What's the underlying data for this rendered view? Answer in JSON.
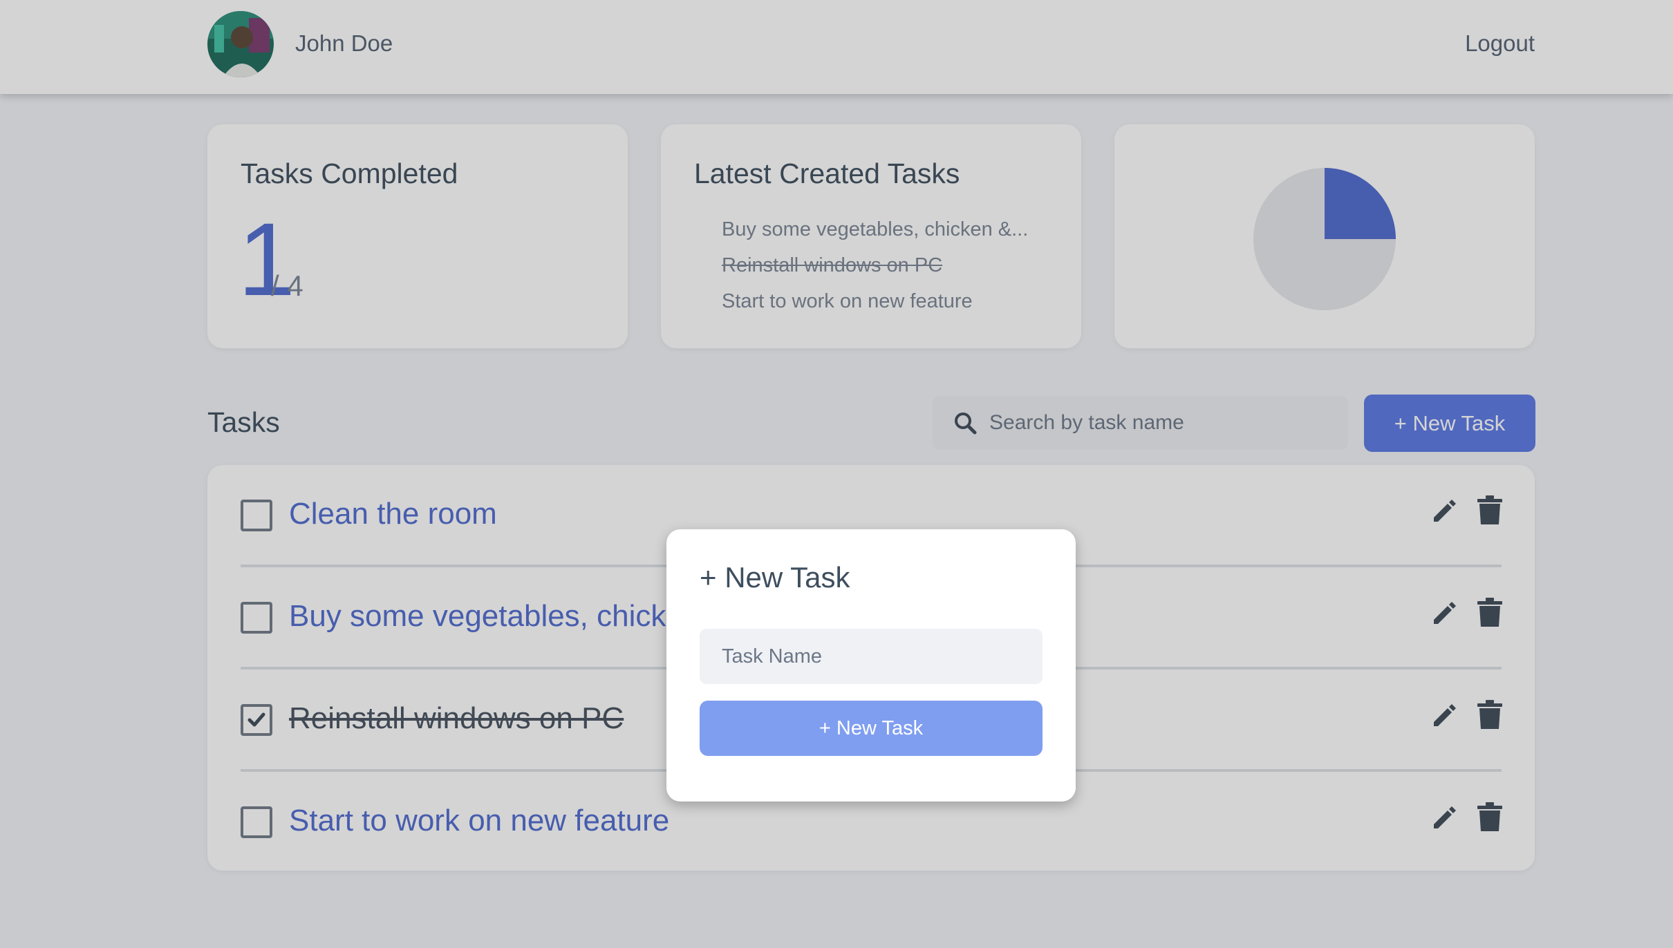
{
  "header": {
    "user_name": "John Doe",
    "logout_label": "Logout"
  },
  "stats": {
    "completed_title": "Tasks Completed",
    "completed_count": "1",
    "total_count": "/ 4",
    "latest_title": "Latest Created Tasks",
    "latest_tasks": [
      {
        "label": "Buy some vegetables, chicken &...",
        "done": false
      },
      {
        "label": "Reinstall windows on PC",
        "done": true
      },
      {
        "label": "Start to work on new feature",
        "done": false
      }
    ],
    "pie": {
      "completed_fraction": 0.25,
      "completed_color": "#4f6bd0",
      "remaining_color": "#e6e8eb"
    }
  },
  "tasks": {
    "heading": "Tasks",
    "search_placeholder": "Search by task name",
    "new_task_label": "+ New Task",
    "items": [
      {
        "label": "Clean the room",
        "done": false
      },
      {
        "label": "Buy some vegetables, chicken & chips",
        "done": false
      },
      {
        "label": "Reinstall windows on PC",
        "done": true
      },
      {
        "label": "Start to work on new feature",
        "done": false
      }
    ]
  },
  "modal": {
    "title": "+ New Task",
    "input_placeholder": "Task Name",
    "submit_label": "+ New Task"
  },
  "colors": {
    "accent": "#5b79e4",
    "task_link": "#4f6bd0",
    "modal_button": "#7f9ef0"
  },
  "icons": [
    "search-icon",
    "pencil-icon",
    "trash-icon",
    "checkmark-icon"
  ]
}
